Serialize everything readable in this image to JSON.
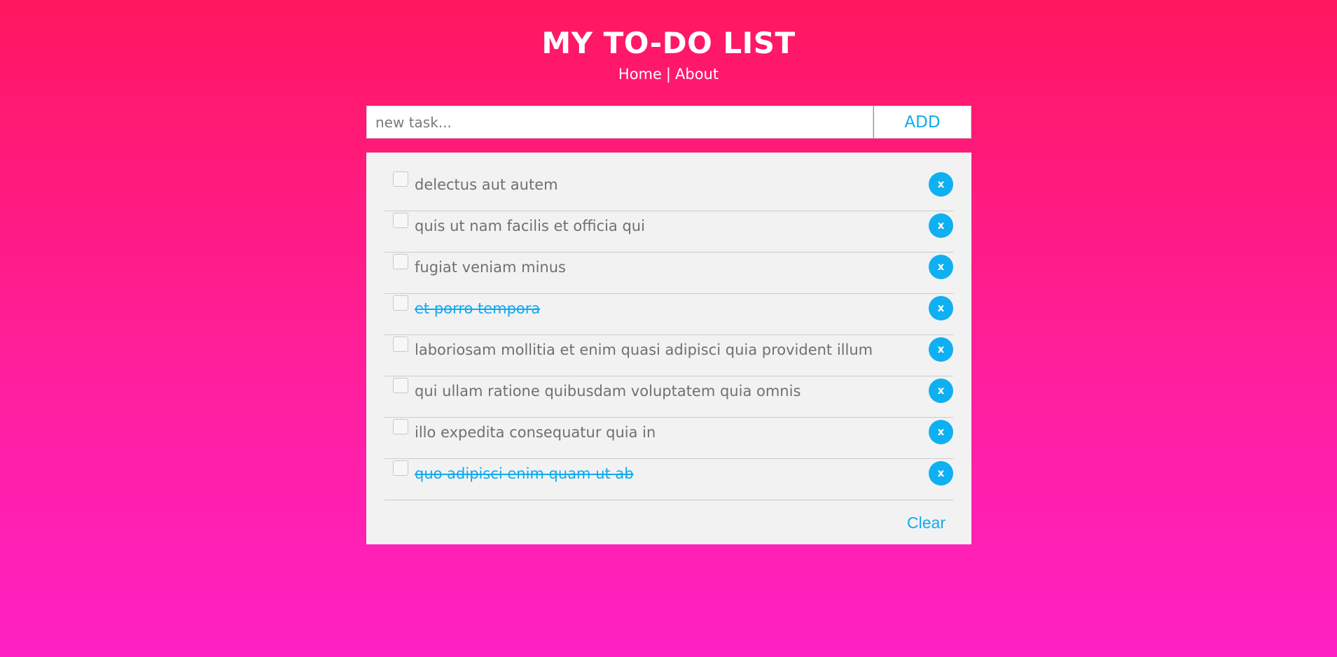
{
  "header": {
    "title": "MY TO-DO LIST",
    "nav": {
      "home": "Home",
      "separator": "|",
      "about": "About"
    }
  },
  "add_form": {
    "input_value": "",
    "input_placeholder": "new task...",
    "add_label": "ADD"
  },
  "todos": [
    {
      "text": "delectus aut autem",
      "completed": false,
      "delete_label": "x"
    },
    {
      "text": "quis ut nam facilis et officia qui",
      "completed": false,
      "delete_label": "x"
    },
    {
      "text": "fugiat veniam minus",
      "completed": false,
      "delete_label": "x"
    },
    {
      "text": "et porro tempora",
      "completed": true,
      "delete_label": "x"
    },
    {
      "text": "laboriosam mollitia et enim quasi adipisci quia provident illum",
      "completed": false,
      "delete_label": "x"
    },
    {
      "text": "qui ullam ratione quibusdam voluptatem quia omnis",
      "completed": false,
      "delete_label": "x"
    },
    {
      "text": "illo expedita consequatur quia in",
      "completed": false,
      "delete_label": "x"
    },
    {
      "text": "quo adipisci enim quam ut ab",
      "completed": true,
      "delete_label": "x"
    }
  ],
  "footer": {
    "clear_label": "Clear"
  },
  "colors": {
    "background_top": "#ff1760",
    "background_bottom": "#ff20c4",
    "accent": "#12a9ef",
    "panel": "#f2f2f2",
    "text": "#707070"
  },
  "icons": {
    "delete": "close-icon",
    "checkbox": "checkbox-icon"
  }
}
